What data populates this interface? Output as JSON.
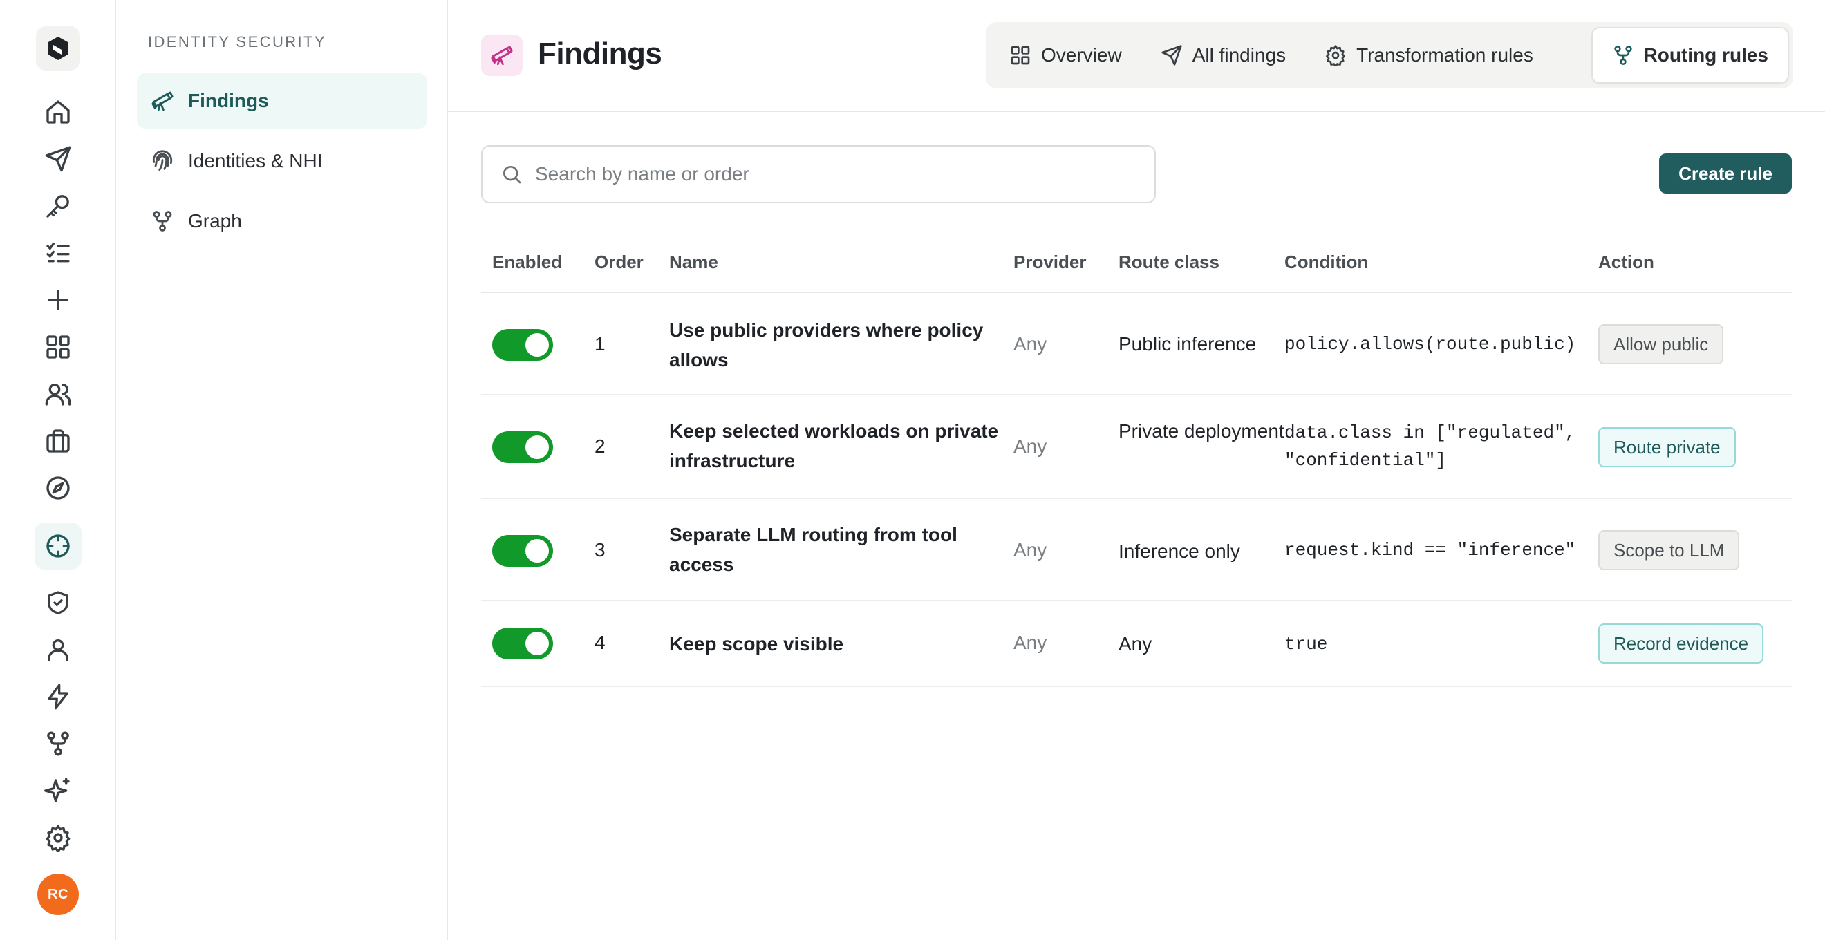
{
  "rail": {
    "avatar_initials": "RC",
    "icons": [
      "home-icon",
      "send-icon",
      "key-icon",
      "checklist-icon",
      "plus-icon",
      "grid-icon",
      "users-icon",
      "briefcase-icon",
      "compass-icon",
      "crosshair-icon",
      "shield-check-icon",
      "user-icon",
      "bolt-icon",
      "git-fork-icon",
      "sparkle-icon",
      "gear-icon"
    ],
    "active_icon": "crosshair-icon"
  },
  "subnav": {
    "section_label": "IDENTITY SECURITY",
    "items": [
      {
        "label": "Findings",
        "icon": "telescope-icon",
        "active": true
      },
      {
        "label": "Identities & NHI",
        "icon": "fingerprint-icon",
        "active": false
      },
      {
        "label": "Graph",
        "icon": "graph-icon",
        "active": false
      }
    ]
  },
  "header": {
    "title": "Findings",
    "icon": "telescope-icon",
    "tabs": [
      {
        "label": "Overview",
        "icon": "grid-icon",
        "active": false
      },
      {
        "label": "All findings",
        "icon": "send-icon",
        "active": false
      },
      {
        "label": "Transformation rules",
        "icon": "gear-icon",
        "active": false
      },
      {
        "label": "Routing rules",
        "icon": "git-fork-icon",
        "active": true
      }
    ]
  },
  "toolbar": {
    "search_placeholder": "Search by name or order",
    "search_value": "",
    "create_label": "Create rule"
  },
  "table": {
    "columns": [
      "Enabled",
      "Order",
      "Name",
      "Provider",
      "Route class",
      "Condition",
      "Action"
    ],
    "rows": [
      {
        "enabled": true,
        "order": "1",
        "name": "Use public providers where policy allows",
        "provider": "Any",
        "route_class": "Public inference",
        "condition": "policy.allows(route.public)",
        "action": "Allow public",
        "action_style": "neutral"
      },
      {
        "enabled": true,
        "order": "2",
        "name": "Keep selected workloads on private infrastructure",
        "provider": "Any",
        "route_class": "Private deployment",
        "condition": "data.class in [\"regulated\", \"confidential\"]",
        "action": "Route private",
        "action_style": "teal"
      },
      {
        "enabled": true,
        "order": "3",
        "name": "Separate LLM routing from tool access",
        "provider": "Any",
        "route_class": "Inference only",
        "condition": "request.kind == \"inference\"",
        "action": "Scope to LLM",
        "action_style": "neutral"
      },
      {
        "enabled": true,
        "order": "4",
        "name": "Keep scope visible",
        "provider": "Any",
        "route_class": "Any",
        "condition": "true",
        "action": "Record evidence",
        "action_style": "teal"
      }
    ]
  },
  "colors": {
    "accent": "#215c5f",
    "toggle_on": "#119a2a",
    "avatar": "#f26b1d",
    "page_icon_bg": "#fbe6f3",
    "page_icon_fg": "#c2308a"
  }
}
